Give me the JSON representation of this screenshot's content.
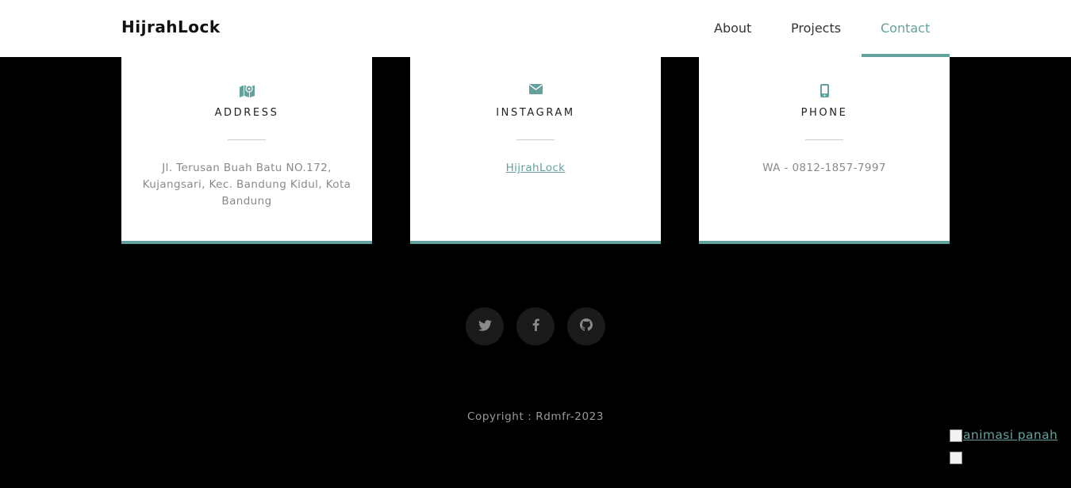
{
  "navbar": {
    "brand": "HijrahLock",
    "links": [
      "About",
      "Projects",
      "Contact"
    ],
    "active": "Contact"
  },
  "cards": [
    {
      "icon": "map-icon",
      "title": "ADDRESS",
      "body": "Jl. Terusan Buah Batu NO.172, Kujangsari, Kec. Bandung Kidul, Kota Bandung"
    },
    {
      "icon": "envelope-icon",
      "title": "INSTAGRAM",
      "link": "HijrahLock"
    },
    {
      "icon": "mobile-phone-icon",
      "title": "PHONE",
      "body": "WA - 0812-1857-7997"
    }
  ],
  "social": [
    "twitter-icon",
    "facebook-icon",
    "github-icon"
  ],
  "footer": {
    "copyright": "Copyright : Rdmfr-2023"
  },
  "floating": {
    "image_alt": "animasi panah"
  },
  "colors": {
    "accent": "#64a19d",
    "background": "#000000",
    "card": "#ffffff"
  }
}
